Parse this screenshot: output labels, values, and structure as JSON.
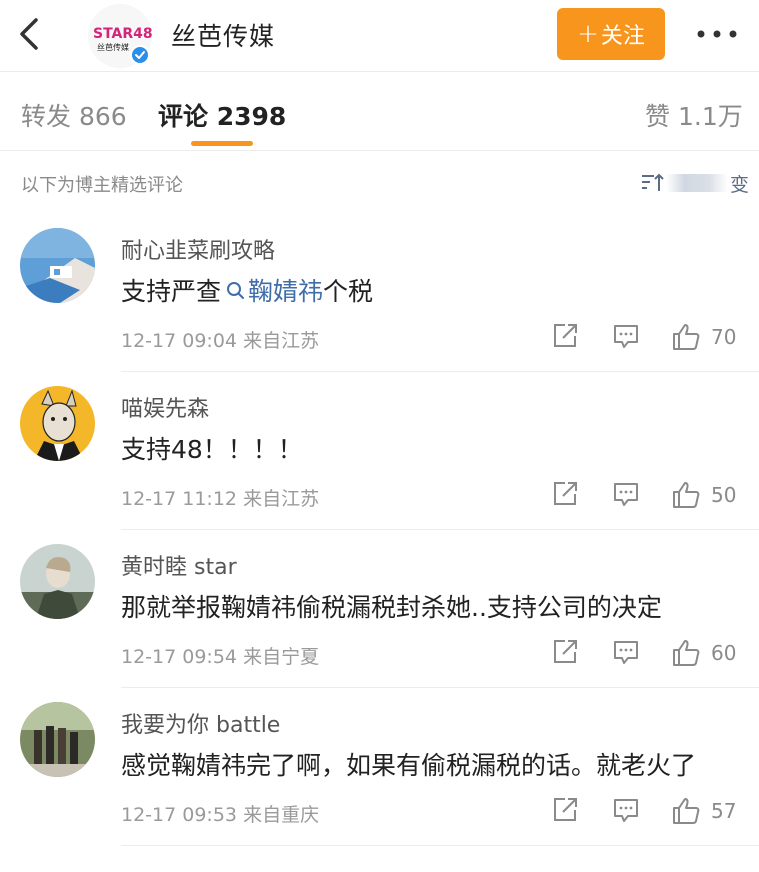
{
  "header": {
    "title": "丝芭传媒",
    "follow_label": "关注",
    "follow_plus": "+",
    "logo_text": "STAR48",
    "logo_sub": "丝芭传媒"
  },
  "tabs": {
    "repost_label": "转发",
    "repost_count": "866",
    "comment_label": "评论",
    "comment_count": "2398",
    "like_label": "赞",
    "like_count": "1.1万"
  },
  "filter": {
    "text": "以下为博主精选评论",
    "sort_label": "变"
  },
  "comments": [
    {
      "name": "耐心韭菜刷攻略",
      "text_before": "支持严查",
      "link": "鞠婧祎",
      "text_after": "个税",
      "date": "12-17 09:04",
      "source": "来自江苏",
      "likes": "70"
    },
    {
      "name": "喵娱先森",
      "text": "支持48！！！！",
      "date": "12-17 11:12",
      "source": "来自江苏",
      "likes": "50"
    },
    {
      "name": "黄时睦 star",
      "text": "那就举报鞠婧祎偷税漏税封杀她..支持公司的决定",
      "date": "12-17 09:54",
      "source": "来自宁夏",
      "likes": "60"
    },
    {
      "name": "我要为你 battle",
      "text": "感觉鞠婧祎完了啊，如果有偷税漏税的话。就老火了",
      "date": "12-17 09:53",
      "source": "来自重庆",
      "likes": "57"
    }
  ],
  "colors": {
    "accent": "#f7951d",
    "link": "#3f6ea8",
    "verified": "#2a8fe8"
  }
}
